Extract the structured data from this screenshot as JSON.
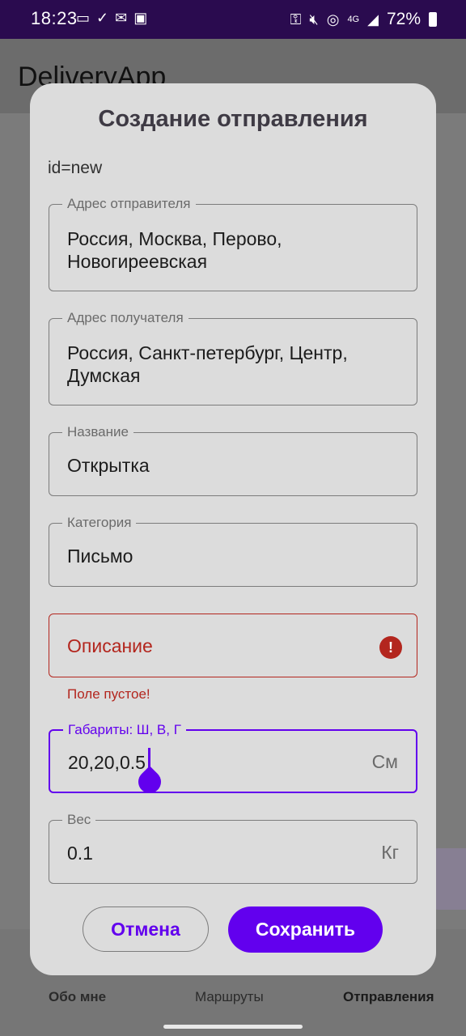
{
  "status_bar": {
    "time": "18:23",
    "left_icons": [
      "cast-icon",
      "check-icon",
      "mail-icon",
      "image-icon"
    ],
    "right_icons": [
      "key-icon",
      "mute-icon",
      "hotspot-icon",
      "4g-icon",
      "signal-icon"
    ],
    "network": "4G",
    "battery": "72%"
  },
  "app": {
    "title": "DeliveryApp",
    "nav": [
      "Обо мне",
      "Маршруты",
      "Отправления"
    ]
  },
  "dialog": {
    "title": "Создание отправления",
    "id_text": "id=new",
    "fields": {
      "sender": {
        "label": "Адрес отправителя",
        "value_line1": "Россия, Москва, Перово,",
        "value_line2": "Новогиреевская"
      },
      "recipient": {
        "label": "Адрес получателя",
        "value_line1": "Россия, Санкт-петербург, Центр,",
        "value_line2": "Думская"
      },
      "name": {
        "label": "Название",
        "value": "Открытка"
      },
      "category": {
        "label": "Категория",
        "value": "Письмо"
      },
      "description": {
        "placeholder": "Описание",
        "error": "Поле пустое!",
        "error_icon": "!"
      },
      "dimensions": {
        "label": "Габариты: Ш, В, Г",
        "value": "20,20,0.5",
        "suffix": "См"
      },
      "weight": {
        "label": "Вес",
        "value": "0.1",
        "suffix": "Кг"
      }
    },
    "buttons": {
      "cancel": "Отмена",
      "save": "Сохранить"
    }
  },
  "colors": {
    "accent": "#6200ee",
    "error": "#b3261e",
    "status_bar": "#2a0b4f",
    "dialog_bg": "#dcdcdc"
  }
}
